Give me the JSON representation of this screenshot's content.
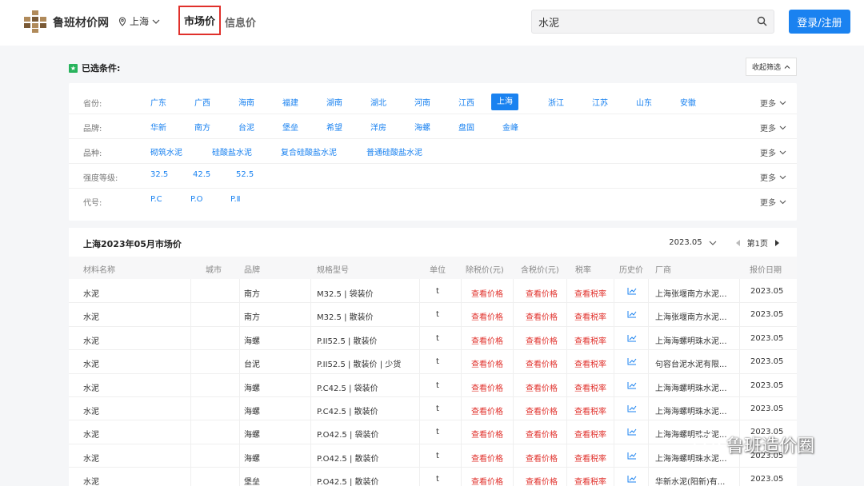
{
  "header": {
    "site_name": "鲁班材价网",
    "city": "上海",
    "nav_market": "市场价",
    "nav_info": "信息价",
    "search_value": "水泥",
    "login_label": "登录/注册"
  },
  "selected": {
    "title": "已选条件:",
    "collapse_label": "收起筛选"
  },
  "filters": [
    {
      "label": "省份:",
      "options": [
        "广东",
        "广西",
        "海南",
        "福建",
        "湖南",
        "湖北",
        "河南",
        "江西",
        "上海",
        "浙江",
        "江苏",
        "山东",
        "安徽"
      ],
      "active": "上海",
      "more": "更多"
    },
    {
      "label": "品牌:",
      "options": [
        "华新",
        "南方",
        "台泥",
        "堡垒",
        "希望",
        "洋房",
        "海螺",
        "盘固",
        "金峰"
      ],
      "active": "",
      "more": "更多"
    },
    {
      "label": "品种:",
      "options": [
        "砌筑水泥",
        "硅酸盐水泥",
        "复合硅酸盐水泥",
        "普通硅酸盐水泥"
      ],
      "active": "",
      "more": "更多"
    },
    {
      "label": "强度等级:",
      "options": [
        "32.5",
        "42.5",
        "52.5"
      ],
      "active": "",
      "more": "更多"
    },
    {
      "label": "代号:",
      "options": [
        "P.C",
        "P.O",
        "P.Ⅱ"
      ],
      "active": "",
      "more": "更多"
    }
  ],
  "table": {
    "title": "上海2023年05月市场价",
    "period": "2023.05",
    "page": "第1页",
    "columns": [
      "材料名称",
      "城市",
      "品牌",
      "规格型号",
      "单位",
      "除税价(元)",
      "含税价(元)",
      "税率",
      "历史价",
      "厂商",
      "报价日期"
    ],
    "rows": [
      {
        "name": "水泥",
        "city": "",
        "brand": "南方",
        "spec": "M32.5 | 袋装价",
        "unit": "t",
        "ex_tax": "查看价格",
        "inc_tax": "查看价格",
        "rate": "查看税率",
        "vendor": "上海张堰南方水泥...",
        "date": "2023.05"
      },
      {
        "name": "水泥",
        "city": "",
        "brand": "南方",
        "spec": "M32.5 | 散装价",
        "unit": "t",
        "ex_tax": "查看价格",
        "inc_tax": "查看价格",
        "rate": "查看税率",
        "vendor": "上海张堰南方水泥...",
        "date": "2023.05"
      },
      {
        "name": "水泥",
        "city": "",
        "brand": "海螺",
        "spec": "P.II52.5 | 散装价",
        "unit": "t",
        "ex_tax": "查看价格",
        "inc_tax": "查看价格",
        "rate": "查看税率",
        "vendor": "上海海螺明珠水泥...",
        "date": "2023.05"
      },
      {
        "name": "水泥",
        "city": "",
        "brand": "台泥",
        "spec": "P.II52.5 | 散装价 | 少货",
        "unit": "t",
        "ex_tax": "查看价格",
        "inc_tax": "查看价格",
        "rate": "查看税率",
        "vendor": "句容台泥水泥有限...",
        "date": "2023.05"
      },
      {
        "name": "水泥",
        "city": "",
        "brand": "海螺",
        "spec": "P.C42.5 | 袋装价",
        "unit": "t",
        "ex_tax": "查看价格",
        "inc_tax": "查看价格",
        "rate": "查看税率",
        "vendor": "上海海螺明珠水泥...",
        "date": "2023.05"
      },
      {
        "name": "水泥",
        "city": "",
        "brand": "海螺",
        "spec": "P.C42.5 | 散装价",
        "unit": "t",
        "ex_tax": "查看价格",
        "inc_tax": "查看价格",
        "rate": "查看税率",
        "vendor": "上海海螺明珠水泥...",
        "date": "2023.05"
      },
      {
        "name": "水泥",
        "city": "",
        "brand": "海螺",
        "spec": "P.O42.5 | 袋装价",
        "unit": "t",
        "ex_tax": "查看价格",
        "inc_tax": "查看价格",
        "rate": "查看税率",
        "vendor": "上海海螺明珠水泥...",
        "date": "2023.05"
      },
      {
        "name": "水泥",
        "city": "",
        "brand": "海螺",
        "spec": "P.O42.5 | 散装价",
        "unit": "t",
        "ex_tax": "查看价格",
        "inc_tax": "查看价格",
        "rate": "查看税率",
        "vendor": "上海海螺明珠水泥...",
        "date": "2023.05"
      },
      {
        "name": "水泥",
        "city": "",
        "brand": "堡垒",
        "spec": "P.O42.5 | 散装价",
        "unit": "t",
        "ex_tax": "查看价格",
        "inc_tax": "查看价格",
        "rate": "查看税率",
        "vendor": "华新水泥(阳新)有...",
        "date": "2023.05"
      }
    ]
  },
  "watermark": "鲁班造价圈",
  "colors": {
    "accent": "#1a82f0",
    "highlight": "#e0302b",
    "green": "#28b35c"
  },
  "icons": [
    "location-pin-icon",
    "chevron-down-icon",
    "search-icon",
    "star-icon",
    "chevron-up-icon",
    "caret-left-icon",
    "caret-right-icon",
    "trend-chart-icon",
    "wechat-icon"
  ]
}
